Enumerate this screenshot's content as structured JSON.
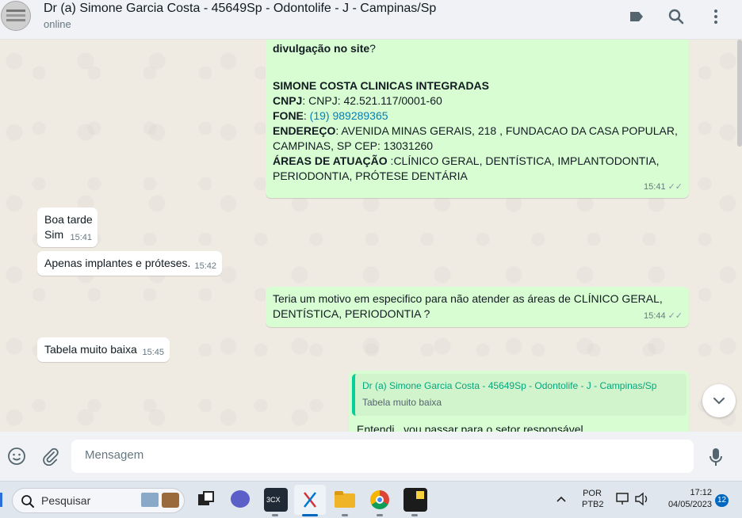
{
  "header": {
    "contact_name": "Dr (a) Simone Garcia Costa - 45649Sp - Odontolife - J - Campinas/Sp",
    "status": "online",
    "icons": [
      "label-icon",
      "search-icon",
      "menu-icon"
    ]
  },
  "messages": {
    "m1": {
      "line_top": "divulgação no site",
      "line_top_q": "?",
      "company": "SIMONE COSTA CLINICAS INTEGRADAS",
      "cnpj_label": "CNPJ",
      "cnpj_value": ": CNPJ: 42.521.117/0001-60",
      "fone_label": "FONE",
      "fone_sep": ": ",
      "fone_value": "(19) 989289365",
      "endereco_label": "ENDEREÇO",
      "endereco_value_1": ": AVENIDA MINAS GERAIS, 218 , FUNDACAO DA CASA POPULAR,",
      "endereco_value_2": "CAMPINAS, SP CEP: 13031260",
      "areas_label": "ÁREAS DE ATUAÇÃO",
      "areas_value_1": " :CLÍNICO GERAL, DENTÍSTICA, IMPLANTODONTIA,",
      "areas_value_2": "PERIODONTIA, PRÓTESE DENTÁRIA",
      "time": "15:41"
    },
    "m2": {
      "line1": "Boa tarde",
      "line2": "Sim",
      "time": "15:41"
    },
    "m3": {
      "text": "Apenas implantes e próteses.",
      "time": "15:42"
    },
    "m4": {
      "line1": "Teria um motivo em especifico para não atender as áreas de CLÍNICO GERAL,",
      "line2": "DENTÍSTICA, PERIODONTIA ?",
      "time": "15:44"
    },
    "m5": {
      "text": "Tabela muito baixa",
      "time": "15:45"
    },
    "m6": {
      "quote_author": "Dr (a) Simone Garcia Costa - 45649Sp - Odontolife - J - Campinas/Sp",
      "quote_text": "Tabela muito baixa",
      "text_partial": "Entendi , vou passar para o setor responsável"
    }
  },
  "composer": {
    "placeholder": "Mensagem"
  },
  "taskbar": {
    "search_placeholder": "Pesquisar",
    "lang_line1": "POR",
    "lang_line2": "PTB2",
    "clock_time": "17:12",
    "clock_date": "04/05/2023",
    "notification_count": "12",
    "app_3cx_label": "3CX"
  },
  "colors": {
    "outgoing": "#d9fdd3",
    "incoming": "#ffffff",
    "background": "#efeae2",
    "link": "#027eb5",
    "accent": "#06cf9c"
  }
}
